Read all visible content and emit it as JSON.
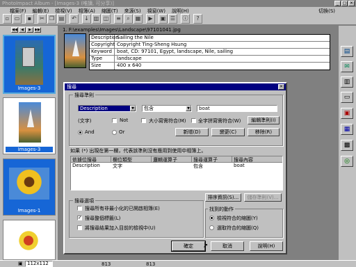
{
  "window": {
    "title": "PhotoImpact Album - [Images-3 (唯讀, 可分享)]",
    "switch": "切換(S)"
  },
  "menu": [
    "檔案(F)",
    "編輯(E)",
    "檢視(V)",
    "相簿(A)",
    "縮圖(T)",
    "來源(S)",
    "視窗(W)",
    "說明(H)"
  ],
  "album": {
    "path": "1. F:\\examples\\Images\\Landscape\\97101041.jpg",
    "info": [
      {
        "k": "Description",
        "v": "Sailing the Nile"
      },
      {
        "k": "Copyright",
        "v": "Copyright Ting-Sheng Hsung"
      },
      {
        "k": "Keyword",
        "v": "boat, CD: 97101, Egypt, landscape, Nile, sailing"
      },
      {
        "k": "Type",
        "v": "landscape"
      },
      {
        "k": "Size",
        "v": "400 x 640"
      }
    ]
  },
  "thumbnails": [
    "Images-3",
    "Images-3",
    "Images-1"
  ],
  "dialog": {
    "title": "搜尋",
    "criteria_label": "搜尋準則",
    "field_select": "Description",
    "op_select": "包含",
    "value": "boat",
    "wen_zi": "(文字)",
    "not_label": "Not",
    "match_case": "大小寫需符合(M)",
    "whole_word": "全字拼寫需符合(W)",
    "edit_criteria": "編輯準則(I)",
    "and_label": "And",
    "or_label": "Or",
    "new_btn": "新增(D)",
    "replace_btn": "變更(C)",
    "remove_btn": "移除(R)",
    "hint": "如果 (*) 出現在第一欄，代表該準則沒有應用到使用中相簿上。",
    "table_headers": [
      "依據位搜尋",
      "欄位類型",
      "邏輯運算子",
      "搜尋運算子",
      "搜尋內容"
    ],
    "table_rows": [
      [
        "Description",
        "文字",
        "",
        "包含",
        "boat"
      ]
    ],
    "options_label": "搜尋選項",
    "opt1": "搜尋所有非最小化的已開啟相簿(E)",
    "opt2": "搜尋整個標籤(L)",
    "opt3": "將搜尋結果加入目前的檢視中(U)",
    "opts_checked": [
      false,
      true,
      false
    ],
    "sort_btn": "排序資訊(S)...",
    "save_btn": "儲存準則(V)...",
    "action_label": "找到的動作",
    "action1": "檢視符合的縮圖(Y)",
    "action2": "選取符合的縮圖(Q)",
    "ok": "確定",
    "cancel": "取消",
    "help": "說明(H)"
  },
  "status": {
    "size": "112x112",
    "count1": "813",
    "count2": "813"
  },
  "colors": {
    "title_active": "#000080",
    "title_inactive": "#808080"
  }
}
